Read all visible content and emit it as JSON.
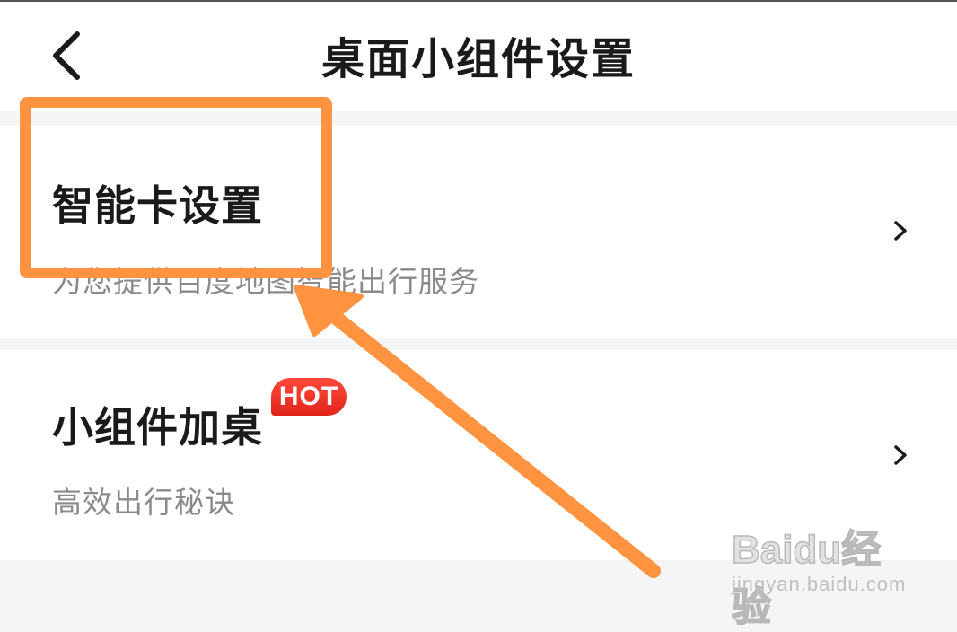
{
  "header": {
    "title": "桌面小组件设置",
    "back_icon": "chevron-left-icon"
  },
  "items": [
    {
      "title": "智能卡设置",
      "subtitle": "为您提供百度地图智能出行服务",
      "icon": "chevron-right-icon"
    },
    {
      "title": "小组件加桌",
      "subtitle": "高效出行秘诀",
      "badge": "HOT",
      "icon": "chevron-right-icon"
    }
  ],
  "annotation": {
    "color": "#ff9340"
  },
  "watermark": {
    "brand": "Baidu经验",
    "url": "jingyan.baidu.com"
  },
  "colors": {
    "badge": "#e8291e",
    "background": "#f4f5f7"
  }
}
